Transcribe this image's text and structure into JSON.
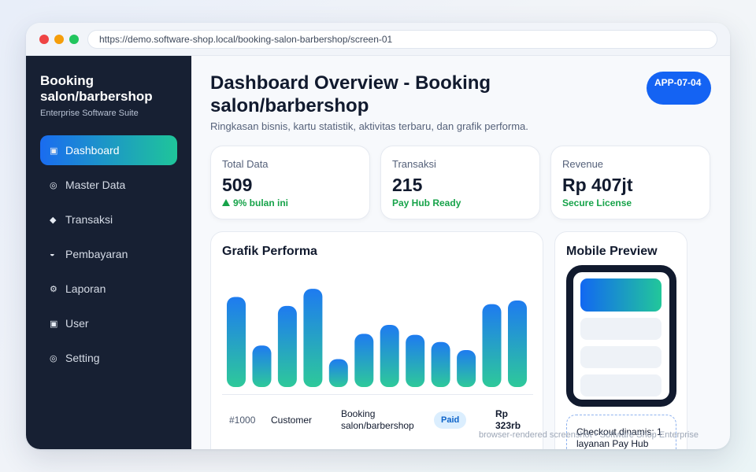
{
  "browser": {
    "url": "https://demo.software-shop.local/booking-salon-barbershop/screen-01"
  },
  "sidebar": {
    "brand_title": "Booking salon/barbershop",
    "brand_subtitle": "Enterprise Software Suite",
    "items": [
      {
        "label": "Dashboard",
        "icon": "▣",
        "active": true
      },
      {
        "label": "Master Data",
        "icon": "◎",
        "active": false
      },
      {
        "label": "Transaksi",
        "icon": "◆",
        "active": false
      },
      {
        "label": "Pembayaran",
        "icon": "◒",
        "active": false
      },
      {
        "label": "Laporan",
        "icon": "⚙",
        "active": false
      },
      {
        "label": "User",
        "icon": "▣",
        "active": false
      },
      {
        "label": "Setting",
        "icon": "◎",
        "active": false
      }
    ]
  },
  "header": {
    "title": "Dashboard Overview - Booking salon/barbershop",
    "subtitle": "Ringkasan bisnis, kartu statistik, aktivitas terbaru, dan grafik performa.",
    "badge": "APP-07-04"
  },
  "stats": [
    {
      "label": "Total Data",
      "value": "509",
      "note": "9% bulan ini",
      "trend_icon": "up-triangle"
    },
    {
      "label": "Transaksi",
      "value": "215",
      "note": "Pay Hub Ready"
    },
    {
      "label": "Revenue",
      "value": "Rp 407jt",
      "note": "Secure License"
    }
  ],
  "chart": {
    "title": "Grafik Performa"
  },
  "chart_data": {
    "type": "bar",
    "values": [
      100,
      46,
      90,
      109,
      31,
      59,
      69,
      58,
      50,
      41,
      92,
      96
    ],
    "ylim": [
      0,
      110
    ],
    "grid": false,
    "colors": {
      "top": "#1e7bf0",
      "bottom": "#2ec99a"
    }
  },
  "table": {
    "rows": [
      {
        "id": "#1000",
        "customer": "Customer",
        "service": "Booking salon/barbershop",
        "status": "Paid",
        "amount": "Rp 323rb"
      }
    ]
  },
  "mobile": {
    "title": "Mobile Preview",
    "checkout": "Checkout dinamis: 1 layanan Pay Hub"
  },
  "footer": "browser-rendered screenshot • Software Shop Enterprise",
  "colors": {
    "accent": "#1463f3",
    "accent_gradient_end": "#1fc59a",
    "sidebar_bg": "#172033",
    "success": "#17a34a"
  }
}
